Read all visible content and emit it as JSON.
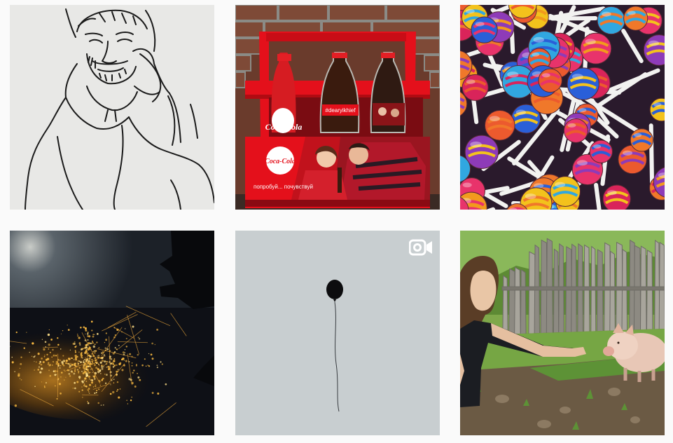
{
  "grid": {
    "posts": [
      {
        "id": "post-1",
        "media": "image",
        "subject": "line-drawing-portrait"
      },
      {
        "id": "post-2",
        "media": "image",
        "subject": "soda-bottle-crate"
      },
      {
        "id": "post-3",
        "media": "image",
        "subject": "lollipops"
      },
      {
        "id": "post-4",
        "media": "image",
        "subject": "night-city-aerial"
      },
      {
        "id": "post-5",
        "media": "video",
        "subject": "black-balloon",
        "badge_icon": "video-camera-icon"
      },
      {
        "id": "post-6",
        "media": "image",
        "subject": "woman-feeding-pig"
      }
    ]
  },
  "post2_text": {
    "bottle_left": "Coca-Cola",
    "bottle_middle": "#dearyikhief",
    "crate_logo": "Coca-Cola",
    "crate_caption": "попробуй... почувствуй"
  },
  "colors": {
    "background": "#fafafa",
    "crate_red": "#e4101b",
    "video_badge": "#ffffff"
  }
}
